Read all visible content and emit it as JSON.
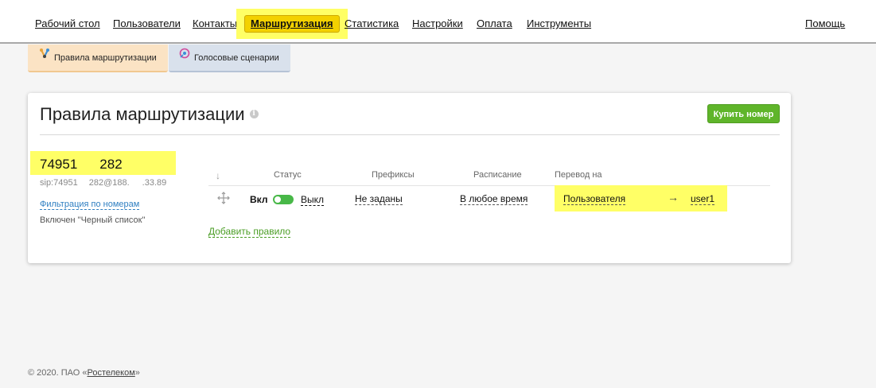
{
  "nav": {
    "items": [
      {
        "label": "Рабочий стол"
      },
      {
        "label": "Пользователи"
      },
      {
        "label": "Контакты"
      },
      {
        "label": "Маршрутизация"
      },
      {
        "label": "Статистика"
      },
      {
        "label": "Настройки"
      },
      {
        "label": "Оплата"
      },
      {
        "label": "Инструменты"
      }
    ],
    "help": "Помощь",
    "active_highlight": "#ffff66",
    "active_button": "#f3d100"
  },
  "subtabs": [
    {
      "label": "Правила маршрутизации",
      "icon": "routing-rules-icon"
    },
    {
      "label": "Голосовые сценарии",
      "icon": "voice-scenario-icon"
    }
  ],
  "card": {
    "title": "Правила маршрутизации",
    "info_icon": "i",
    "buy_button": "Купить номер",
    "number": {
      "part1": "74951",
      "part2": "282",
      "sip1": "sip:74951",
      "sip2": "282@188.",
      "sip3": ".33.89"
    },
    "filter_link": "Фильтрация по номерам",
    "blacklist": "Включен \"Черный список\"",
    "table": {
      "sort_icon": "↓",
      "headers": [
        "Статус",
        "Префиксы",
        "Расписание",
        "Перевод на"
      ],
      "row": {
        "on": "Вкл",
        "off": "Выкл",
        "toggle_on": true,
        "prefixes": "Не заданы",
        "schedule": "В любое время",
        "forward_type": "Пользователя",
        "arrow": "→",
        "forward_target": "user1"
      }
    },
    "add_rule": "Добавить правило"
  },
  "footer": {
    "prefix": "© 2020. ПАО «",
    "link": "Ростелеком",
    "suffix": "»"
  },
  "colors": {
    "highlight": "#ffff66",
    "buy_button": "#5fb52a",
    "toggle": "#48b848",
    "link_blue": "#2f7fc1",
    "link_green": "#4a9d24"
  }
}
